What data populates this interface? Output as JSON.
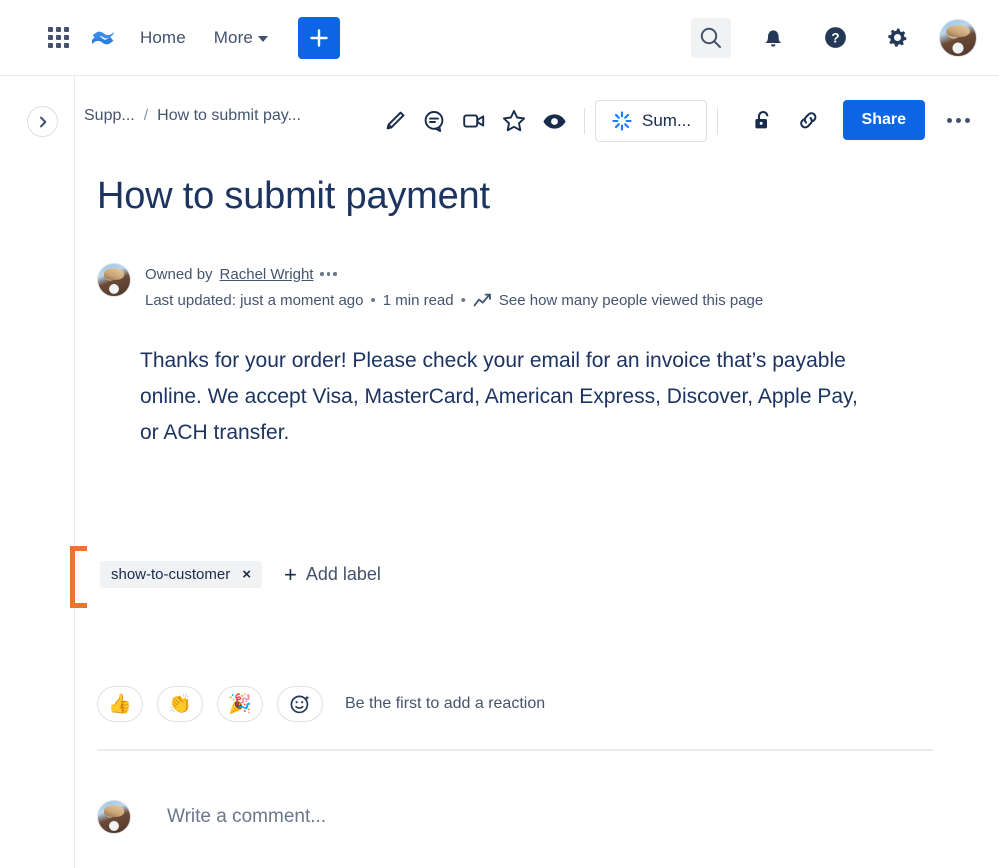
{
  "topnav": {
    "app_switcher_icon": "grid-icon",
    "product_logo_icon": "confluence-logo-icon",
    "home_label": "Home",
    "more_label": "More",
    "create_icon": "plus-icon",
    "search_icon": "search-icon",
    "notifications_icon": "bell-icon",
    "help_icon": "help-circle-icon",
    "settings_icon": "gear-icon",
    "avatar_icon": "user-avatar"
  },
  "pagebar": {
    "expand_icon": "chevron-right-icon",
    "breadcrumb": {
      "space": "Supp...",
      "separator": "/",
      "page": "How to submit pay..."
    },
    "tools": [
      {
        "name": "edit-pencil-icon"
      },
      {
        "name": "comment-icon"
      },
      {
        "name": "video-icon"
      },
      {
        "name": "star-icon"
      },
      {
        "name": "watch-eye-icon"
      }
    ],
    "summarize": {
      "label": "Sum...",
      "icon": "ai-sparkle-icon"
    },
    "restrictions_icon": "unlock-icon",
    "copy_link_icon": "link-icon",
    "share_label": "Share",
    "more_actions_icon": "ellipsis-icon"
  },
  "page": {
    "title": "How to submit payment",
    "owner_prefix": "Owned by",
    "owner_name": "Rachel Wright",
    "owner_more_icon": "ellipsis-icon",
    "last_updated": "Last updated: just a moment ago",
    "bullet": "•",
    "read_time": "1 min read",
    "analytics_icon": "chart-line-icon",
    "analytics_label": "See how many people viewed this page",
    "body": "Thanks for your order! Please check your email for an invoice that’s payable online. We accept Visa, MasterCard, American Express, Discover, Apple Pay, or ACH transfer."
  },
  "labels": {
    "chip_text": "show-to-customer",
    "chip_remove_icon": "×",
    "add_label": "Add label",
    "add_icon": "plus-icon",
    "highlight_color": "#e8762c"
  },
  "reactions": {
    "quick": [
      "👍",
      "👏",
      "🎉"
    ],
    "picker_icon": "emoji-plus-icon",
    "hint": "Be the first to add a reaction"
  },
  "comment": {
    "avatar_icon": "user-avatar",
    "placeholder": "Write a comment..."
  },
  "colors": {
    "brand_blue": "#0c66e4",
    "text_navy": "#1d3461",
    "text_subtle": "#44546f",
    "highlight_orange": "#e8762c"
  }
}
